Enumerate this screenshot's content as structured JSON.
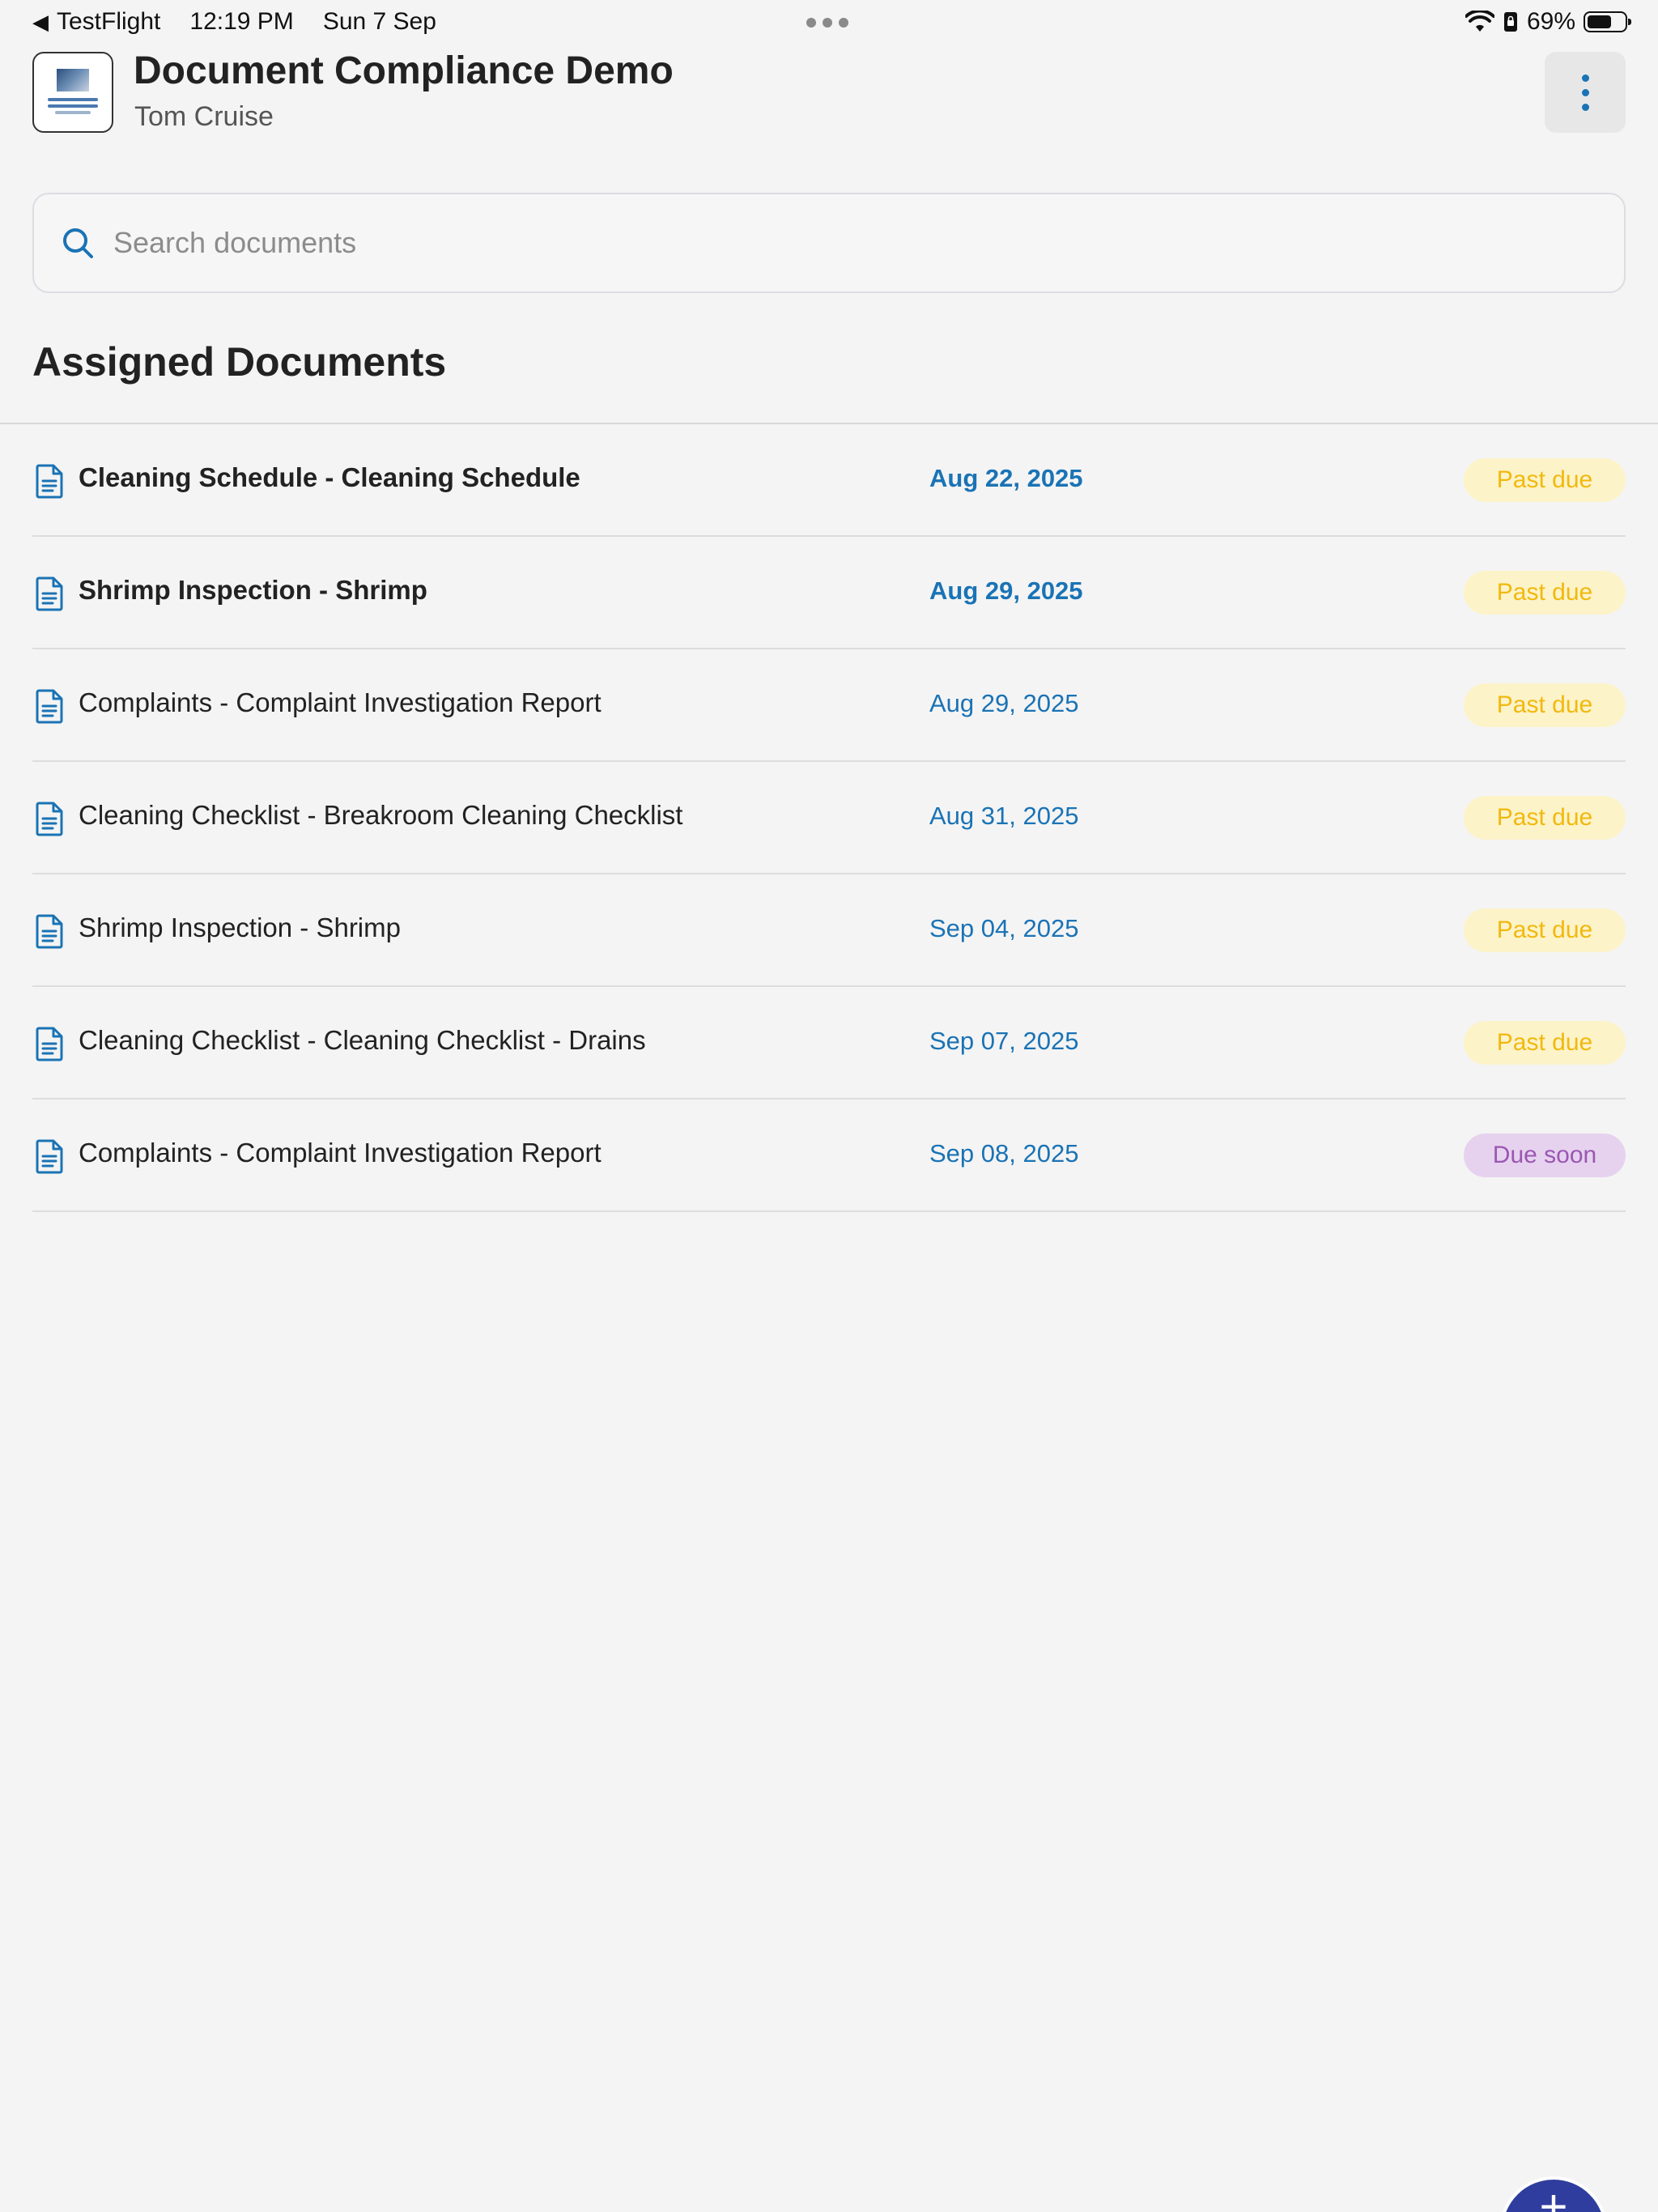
{
  "status_bar": {
    "back_app": "TestFlight",
    "time": "12:19 PM",
    "date": "Sun 7 Sep",
    "battery_percent": "69%",
    "battery_level": 0.69
  },
  "header": {
    "title": "Document Compliance Demo",
    "user_name": "Tom Cruise"
  },
  "search": {
    "placeholder": "Search documents",
    "value": ""
  },
  "section_title": "Assigned Documents",
  "documents": [
    {
      "title": "Cleaning Schedule - Cleaning Schedule",
      "due": "Aug 22, 2025",
      "status": "Past due",
      "bold": true
    },
    {
      "title": "Shrimp Inspection - Shrimp",
      "due": "Aug 29, 2025",
      "status": "Past due",
      "bold": true
    },
    {
      "title": "Complaints - Complaint Investigation Report",
      "due": "Aug 29, 2025",
      "status": "Past due",
      "bold": false
    },
    {
      "title": "Cleaning Checklist - Breakroom Cleaning Checklist",
      "due": "Aug 31, 2025",
      "status": "Past due",
      "bold": false
    },
    {
      "title": "Shrimp Inspection - Shrimp",
      "due": "Sep 04, 2025",
      "status": "Past due",
      "bold": false
    },
    {
      "title": "Cleaning Checklist - Cleaning Checklist - Drains",
      "due": "Sep 07, 2025",
      "status": "Past due",
      "bold": false
    },
    {
      "title": "Complaints - Complaint Investigation Report",
      "due": "Sep 08, 2025",
      "status": "Due soon",
      "bold": false
    }
  ],
  "fab": {
    "label": "+"
  },
  "colors": {
    "accent": "#1a73b5",
    "past_due_text": "#f1b90e",
    "past_due_bg": "#fdf3c9",
    "due_soon_text": "#9a57b3",
    "due_soon_bg": "#e6d2ee",
    "fab": "#2f3e9e"
  },
  "icons": {
    "back": "back-arrow-icon",
    "wifi": "wifi-icon",
    "lock_rotation": "orientation-lock-icon",
    "battery": "battery-icon",
    "menu": "more-vertical-icon",
    "search": "search-icon",
    "document": "document-icon",
    "add": "plus-icon"
  }
}
